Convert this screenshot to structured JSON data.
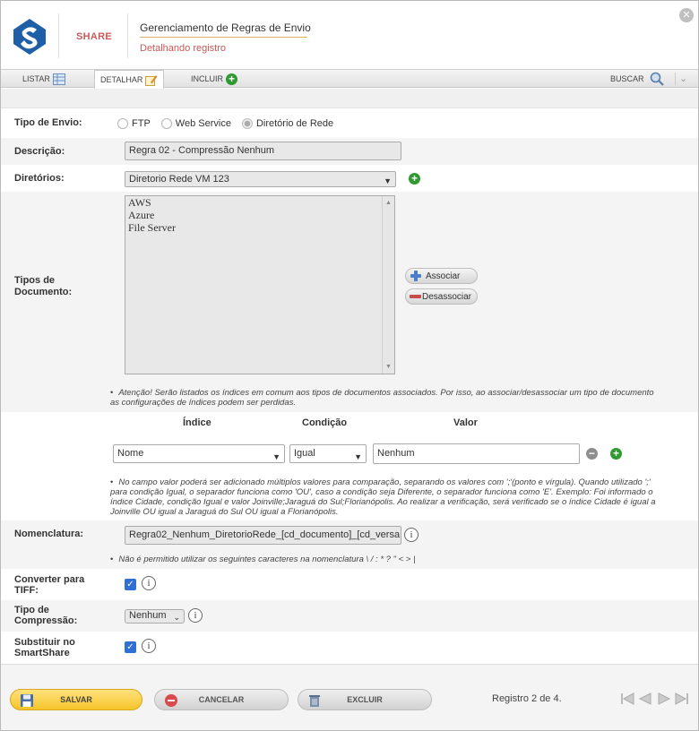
{
  "header": {
    "brand": "SHARE",
    "title": "Gerenciamento de Regras de Envio",
    "subtitle": "Detalhando registro",
    "close_icon": "close-icon"
  },
  "tabs": [
    {
      "label": "LISTAR",
      "icon": "list-icon"
    },
    {
      "label": "DETALHAR",
      "icon": "edit-icon",
      "active": true
    },
    {
      "label": "INCLUIR",
      "icon": "add-icon"
    }
  ],
  "search": {
    "label": "BUSCAR",
    "icon": "search-icon"
  },
  "form": {
    "tipo_envio": {
      "label": "Tipo de Envio:",
      "options": [
        "FTP",
        "Web Service",
        "Diretório de Rede"
      ],
      "selected": "Diretório de Rede"
    },
    "descricao": {
      "label": "Descrição:",
      "value": "Regra 02 - Compressão Nenhum"
    },
    "diretorios": {
      "label": "Diretórios:",
      "value": "Diretorio Rede VM 123"
    },
    "tipos_documento": {
      "label_line1": "Tipos de",
      "label_line2": "Documento:",
      "items": [
        "AWS",
        "Azure",
        "File Server"
      ],
      "associar": "Associar",
      "desassociar": "Desassociar",
      "note_line1": "Atenção! Serão listados os índices em comum aos tipos de documentos associados. Por isso, ao associar/desassociar um tipo de documento",
      "note_line2": "as configurações de índices podem ser perdidas."
    },
    "indices": {
      "col_indice": "Índice",
      "col_condicao": "Condição",
      "col_valor": "Valor",
      "indice_value": "Nome",
      "condicao_value": "Igual",
      "valor_value": "Nenhum",
      "note_line1": "No campo valor poderá ser adicionado múltiplos valores para comparação, separando os valores com ';'(ponto e vírgula). Quando utilizado ';'",
      "note_line2": "para condição Igual, o separador funciona como 'OU', caso a condição seja Diferente, o separador funciona como 'E'. Exemplo: Foi informado o",
      "note_line3": "índice Cidade, condição Igual e valor Joinville;Jaraguá do Sul;Florianópolis. Ao realizar a verificação, será verificado se o índice Cidade é igual a",
      "note_line4": "Joinville OU igual a Jaraguá do Sul OU igual a Florianópolis."
    },
    "nomenclatura": {
      "label": "Nomenclatura:",
      "value": "Regra02_Nenhum_DiretorioRede_[cd_documento]_[cd_versa",
      "note": "Não é permitido utilizar os seguintes caracteres na nomenclatura \\ / : * ? \" < > |"
    },
    "converter_tiff": {
      "label_line1": "Converter para",
      "label_line2": "TIFF:",
      "checked": true
    },
    "tipo_compressao": {
      "label_line1": "Tipo de",
      "label_line2": "Compressão:",
      "value": "Nenhum"
    },
    "substituir": {
      "label_line1": "Substituir no",
      "label_line2": "SmartShare",
      "checked": true
    }
  },
  "footer": {
    "save": "SALVAR",
    "cancel": "CANCELAR",
    "delete": "EXCLUIR",
    "record": "Registro 2 de 4."
  },
  "colors": {
    "accent": "#f5c42a",
    "brand": "#c75a5a",
    "green": "#2f9a2f",
    "checkbox": "#2f6fd6"
  }
}
